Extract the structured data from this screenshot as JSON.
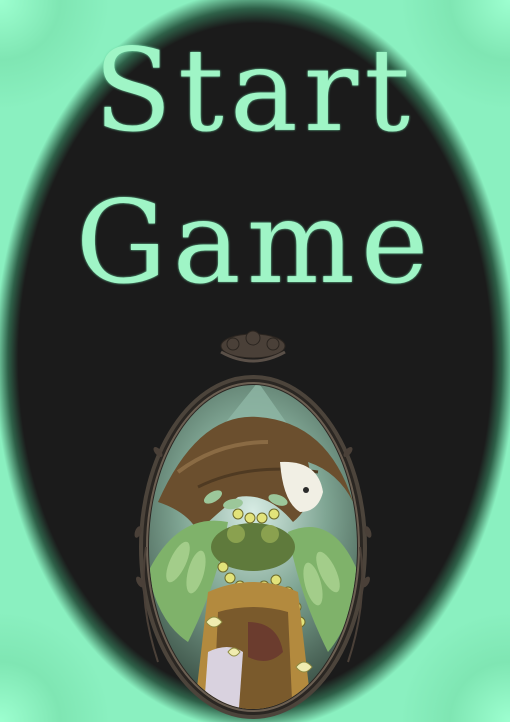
{
  "menu": {
    "start_line1": "Start",
    "start_line2": "Game"
  },
  "colors": {
    "accent": "#9ff5c6",
    "background": "#1b1b1b",
    "frame": "#3a3530"
  },
  "portrait": {
    "icon": "forest-spirit-character-portrait"
  }
}
